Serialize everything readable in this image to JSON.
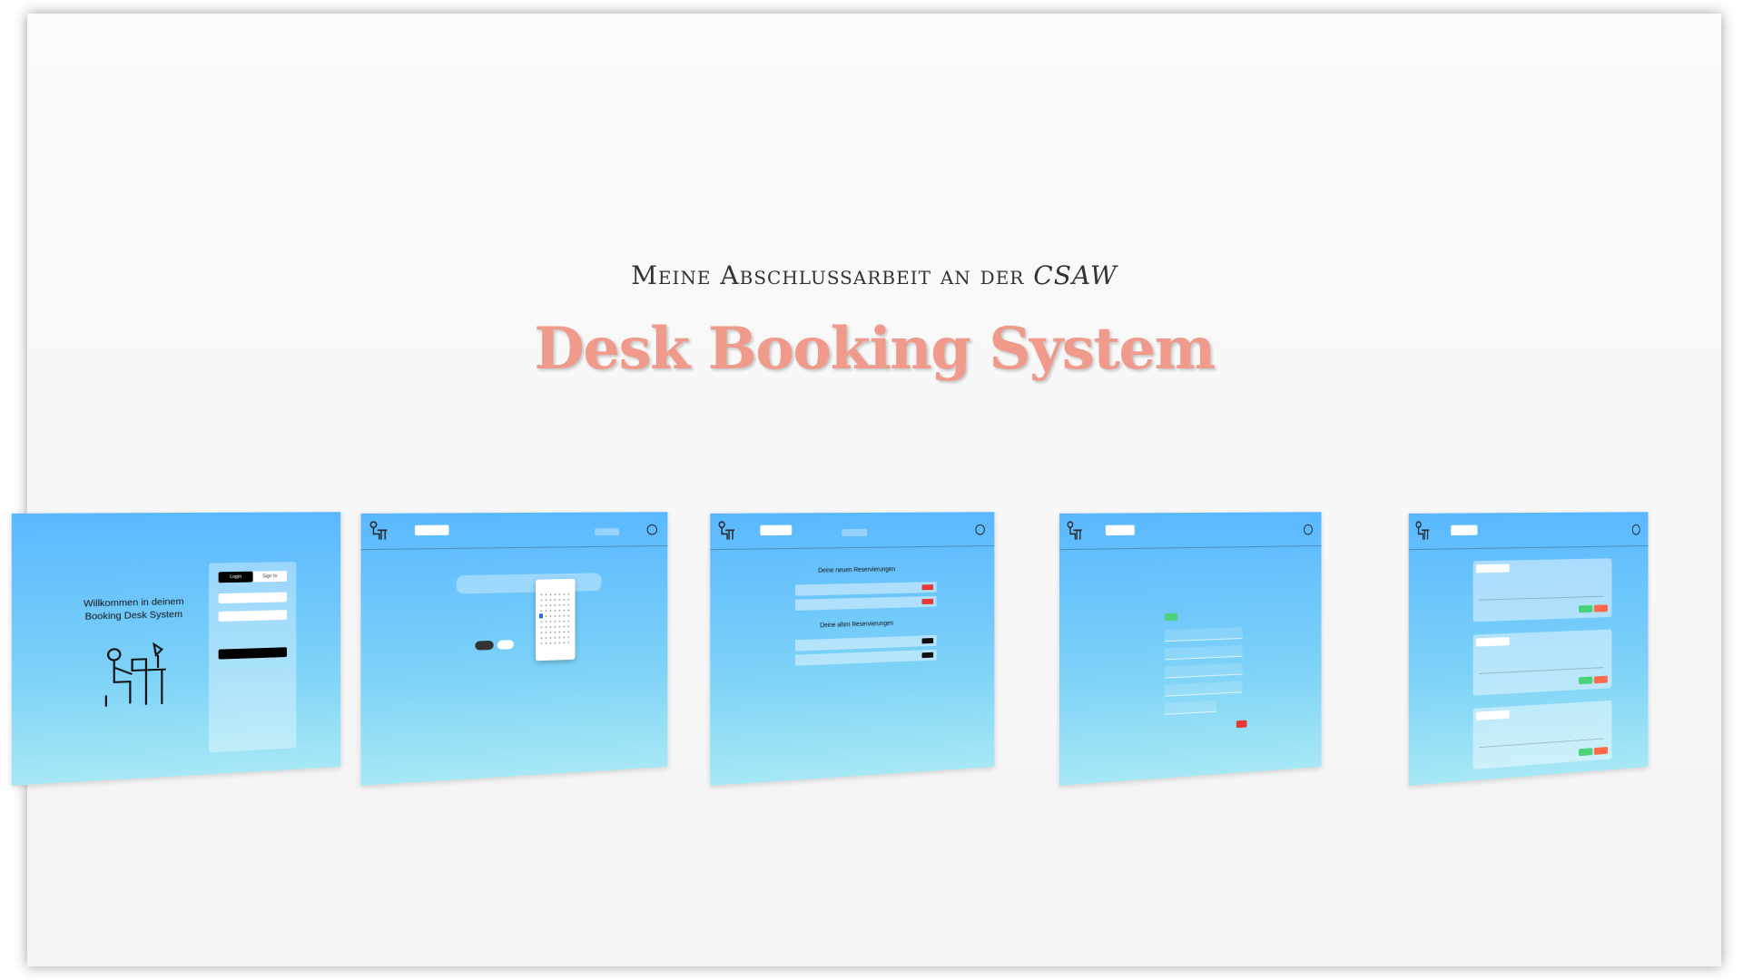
{
  "header": {
    "subtitle_prefix": "Meine Abschlussarbeit an der",
    "subtitle_italic": "CSAW",
    "title": "Desk Booking System"
  },
  "screens": {
    "login": {
      "welcome_line1": "Willkommen in deinem",
      "welcome_line2": "Booking Desk System",
      "tab_login": "Login",
      "tab_signup": "Sign In"
    },
    "booking": {},
    "reservations": {
      "new_heading": "Deine neuen Reservierungen",
      "old_heading": "Deine alten Reservierungen"
    },
    "profile": {},
    "overview": {}
  },
  "colors": {
    "title": "#f09a8b",
    "screen_gradient_top": "#5ab8ff",
    "screen_gradient_bottom": "#a7e8f6",
    "danger": "#e53935",
    "success": "#4cd37a"
  }
}
